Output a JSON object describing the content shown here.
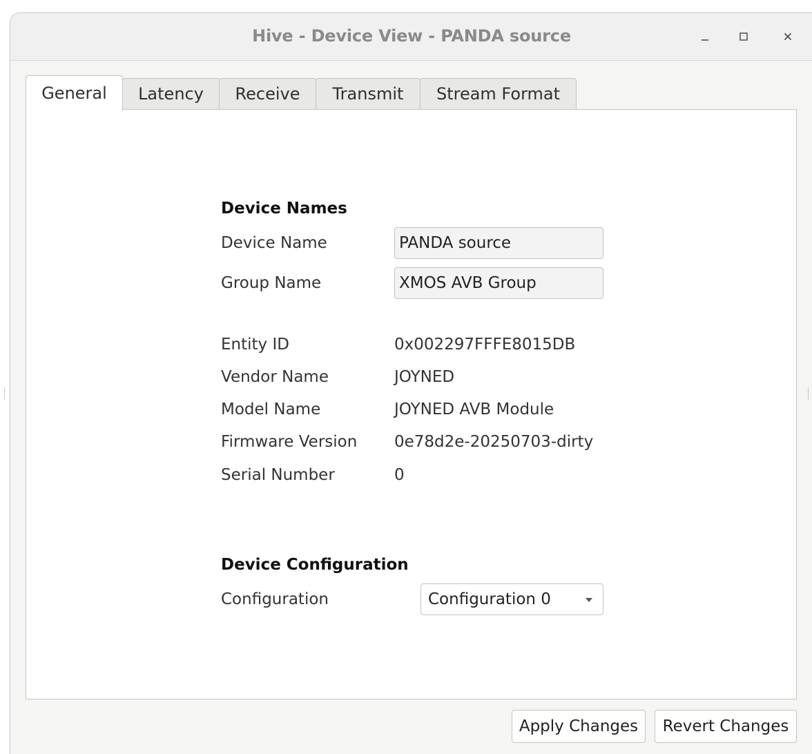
{
  "window": {
    "title": "Hive - Device View - PANDA source"
  },
  "tabs": [
    {
      "label": "General",
      "active": true
    },
    {
      "label": "Latency",
      "active": false
    },
    {
      "label": "Receive",
      "active": false
    },
    {
      "label": "Transmit",
      "active": false
    },
    {
      "label": "Stream Format",
      "active": false
    }
  ],
  "device_names": {
    "section_title": "Device Names",
    "device_name_label": "Device Name",
    "device_name_value": "PANDA source",
    "group_name_label": "Group Name",
    "group_name_value": "XMOS AVB Group"
  },
  "info": [
    {
      "label": "Entity ID",
      "value": "0x002297FFFE8015DB"
    },
    {
      "label": "Vendor Name",
      "value": "JOYNED"
    },
    {
      "label": "Model Name",
      "value": "JOYNED AVB Module"
    },
    {
      "label": "Firmware Version",
      "value": "0e78d2e-20250703-dirty"
    },
    {
      "label": "Serial Number",
      "value": "0"
    }
  ],
  "device_configuration": {
    "section_title": "Device Configuration",
    "configuration_label": "Configuration",
    "configuration_selected": "Configuration 0"
  },
  "buttons": {
    "apply": "Apply Changes",
    "revert": "Revert Changes"
  },
  "icons": {
    "minimize": "minimize-icon",
    "maximize": "maximize-icon",
    "close": "close-icon",
    "dropdown": "chevron-down-icon"
  }
}
